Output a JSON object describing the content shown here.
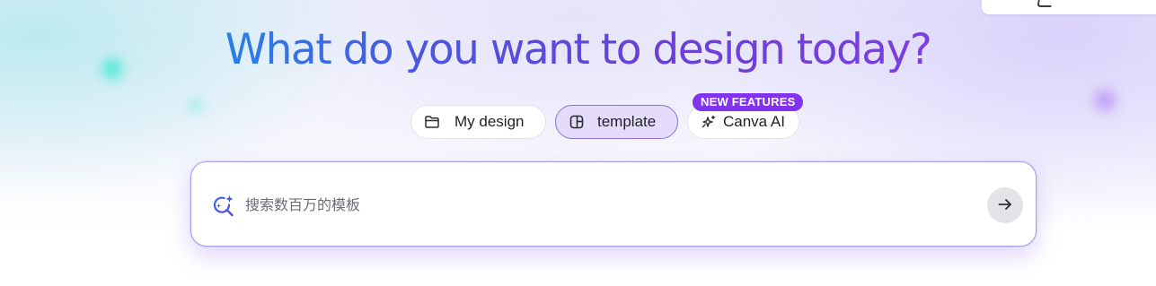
{
  "header": {
    "headline": "What do you want to design today?"
  },
  "tabs": [
    {
      "label": "My design",
      "icon": "folder-icon",
      "selected": false
    },
    {
      "label": "template",
      "icon": "template-icon",
      "selected": true
    },
    {
      "label": "Canva AI",
      "icon": "sparkle-icon",
      "selected": false,
      "badge": "NEW FEATURES"
    }
  ],
  "search": {
    "placeholder": "搜索数百万的模板",
    "value": "",
    "icon": "ai-search-icon",
    "submit_icon": "arrow-right-icon"
  },
  "colors": {
    "headline_gradient_start": "#2a7fe8",
    "headline_gradient_end": "#7b3fdd",
    "badge": "#8134ec",
    "selected_tab_bg": "#e4dcfa",
    "selected_tab_border": "#8d6fd6"
  }
}
